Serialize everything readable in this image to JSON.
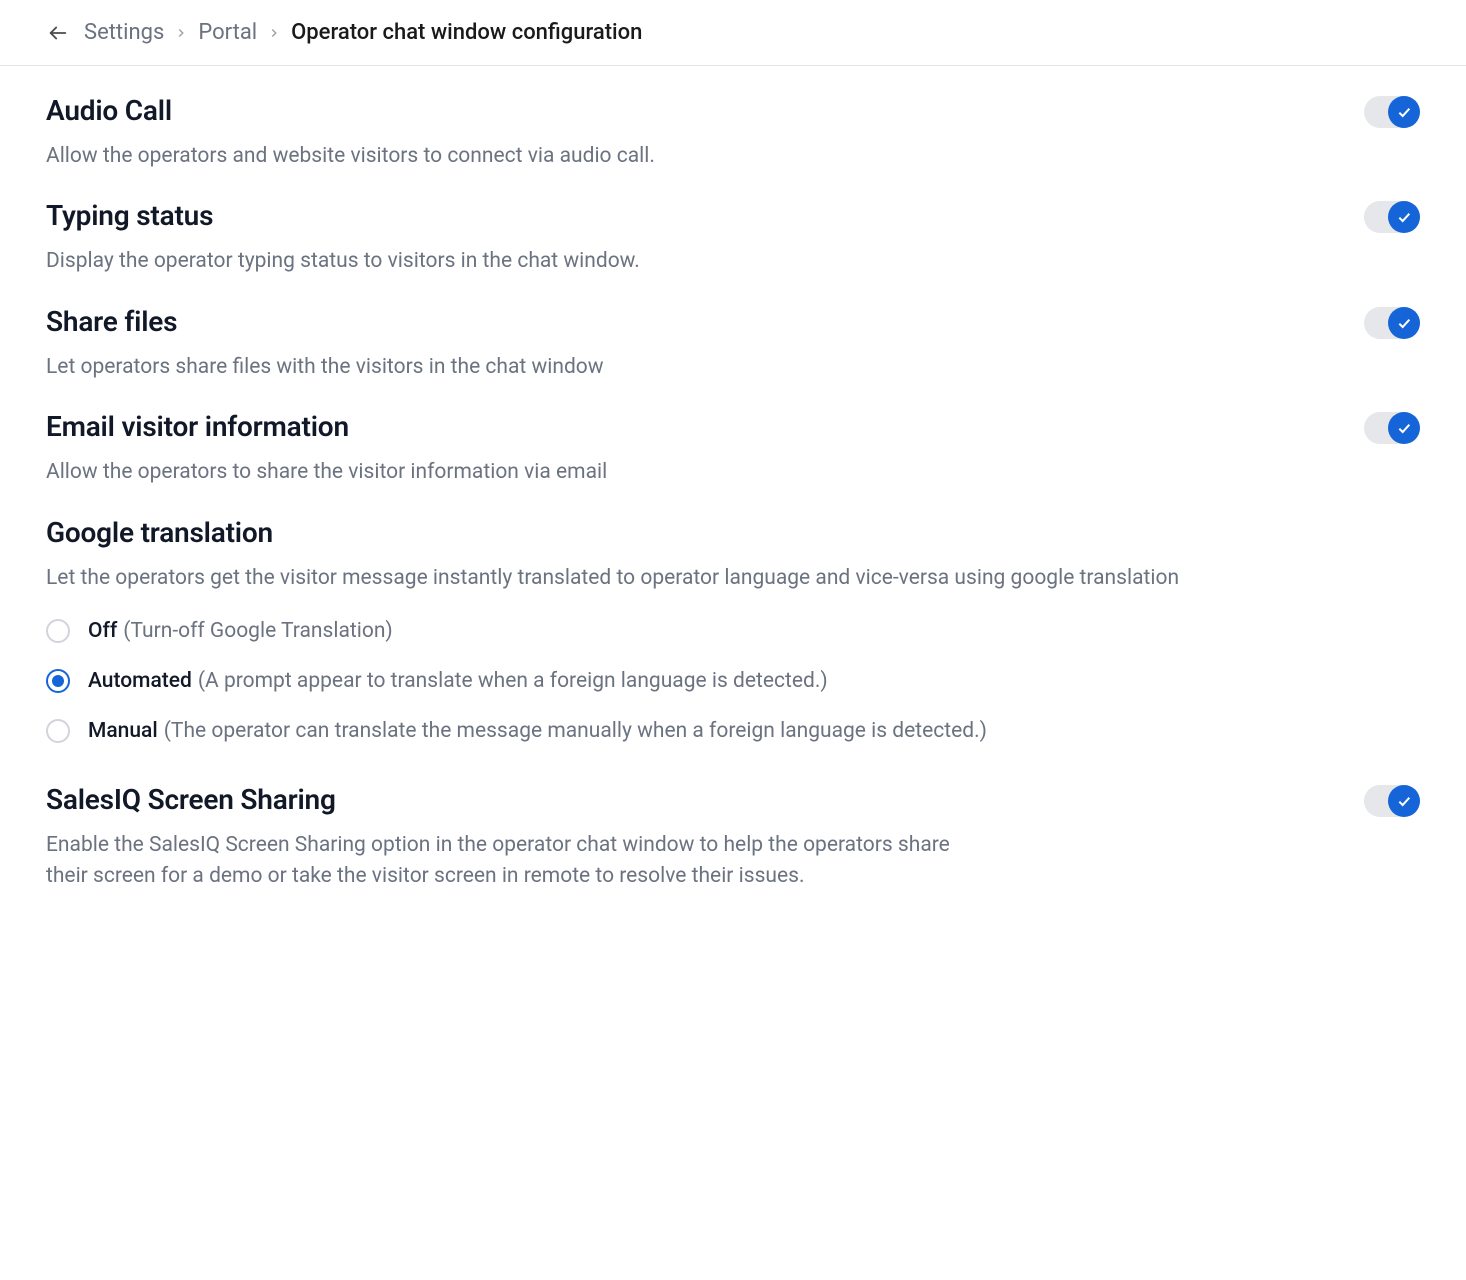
{
  "breadcrumb": {
    "items": [
      "Settings",
      "Portal",
      "Operator chat window configuration"
    ]
  },
  "settings": {
    "audio_call": {
      "title": "Audio Call",
      "desc": "Allow the operators and website visitors to connect via audio call.",
      "on": true
    },
    "typing_status": {
      "title": "Typing status",
      "desc": "Display the operator typing status to visitors in the chat window.",
      "on": true
    },
    "share_files": {
      "title": "Share files",
      "desc": "Let operators share files with the visitors in the chat window",
      "on": true
    },
    "email_visitor": {
      "title": "Email visitor information",
      "desc": "Allow the operators to share the visitor information via email",
      "on": true
    },
    "google_translation": {
      "title": "Google translation",
      "desc": "Let the operators get the visitor message instantly translated to operator language and vice-versa using google translation",
      "selected": "automated",
      "options": {
        "off": {
          "label": "Off",
          "hint": "(Turn-off Google Translation)"
        },
        "automated": {
          "label": "Automated",
          "hint": "(A prompt appear to translate when a foreign language is detected.)"
        },
        "manual": {
          "label": "Manual",
          "hint": "(The operator can translate the message manually when a foreign language is detected.)"
        }
      }
    },
    "screen_sharing": {
      "title": "SalesIQ Screen Sharing",
      "desc": "Enable the SalesIQ Screen Sharing option in the operator chat window to help the operators share their screen for a demo or take the visitor screen in remote to resolve their issues.",
      "on": true
    }
  }
}
